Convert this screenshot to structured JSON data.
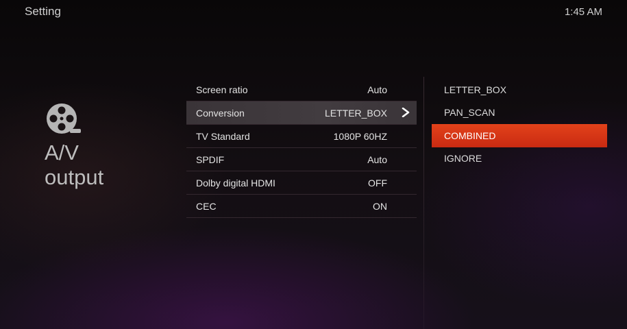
{
  "header": {
    "title": "Setting",
    "clock": "1:45 AM"
  },
  "section": {
    "icon": "film-reel-icon",
    "title_line1": "A/V",
    "title_line2": "output"
  },
  "settings": [
    {
      "label": "Screen ratio",
      "value": "Auto"
    },
    {
      "label": "Conversion",
      "value": "LETTER_BOX",
      "selected": true
    },
    {
      "label": "TV Standard",
      "value": "1080P 60HZ"
    },
    {
      "label": "SPDIF",
      "value": "Auto"
    },
    {
      "label": "Dolby digital HDMI",
      "value": "OFF"
    },
    {
      "label": "CEC",
      "value": "ON"
    }
  ],
  "options": [
    {
      "label": "LETTER_BOX"
    },
    {
      "label": "PAN_SCAN"
    },
    {
      "label": "COMBINED",
      "highlighted": true
    },
    {
      "label": "IGNORE"
    }
  ],
  "colors": {
    "highlight": "#d8341a",
    "selected_row": "#3e383c"
  }
}
